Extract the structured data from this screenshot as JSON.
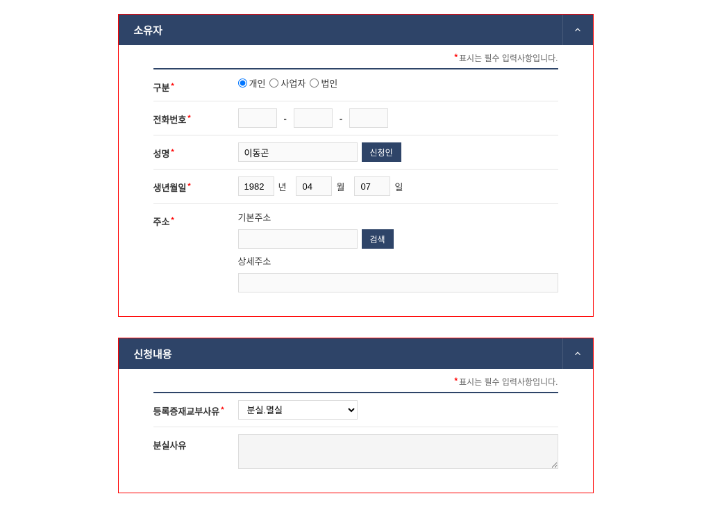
{
  "requiredNote": "표시는 필수 입력사항입니다.",
  "owner": {
    "title": "소유자",
    "fields": {
      "type": {
        "label": "구분",
        "options": {
          "individual": "개인",
          "business": "사업자",
          "corporation": "법인"
        },
        "value": "individual"
      },
      "phone": {
        "label": "전화번호",
        "p1": "",
        "p2": "",
        "p3": ""
      },
      "name": {
        "label": "성명",
        "value": "이동곤",
        "applicantBtn": "신청인"
      },
      "birth": {
        "label": "생년월일",
        "year": "1982",
        "yearUnit": "년",
        "month": "04",
        "monthUnit": "월",
        "day": "07",
        "dayUnit": "일"
      },
      "address": {
        "label": "주소",
        "baseLabel": "기본주소",
        "baseValue": "",
        "searchBtn": "검색",
        "detailLabel": "상세주소",
        "detailValue": ""
      }
    }
  },
  "request": {
    "title": "신청내용",
    "fields": {
      "reissueReason": {
        "label": "등록증재교부사유",
        "selected": "분실.멸실",
        "options": [
          "분실.멸실"
        ]
      },
      "lossReason": {
        "label": "분실사유",
        "value": ""
      }
    }
  }
}
